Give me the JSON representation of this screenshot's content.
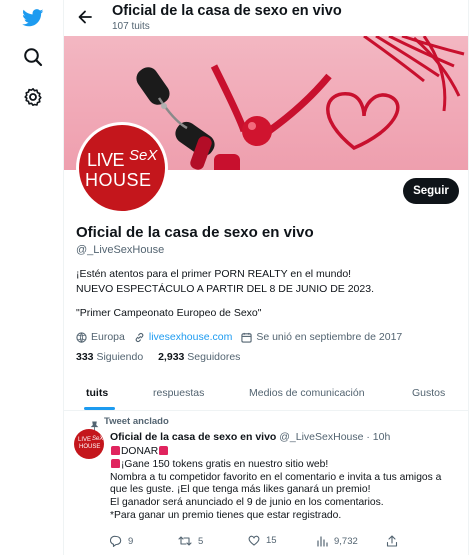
{
  "colors": {
    "brand": "#1d9bf0",
    "text": "#0f1419",
    "muted": "#536471",
    "logo_red": "#c4161c"
  },
  "nav": {
    "icons": [
      "twitter-logo",
      "search-icon",
      "gear-icon"
    ]
  },
  "header": {
    "title": "Oficial de la casa de sexo en vivo",
    "subtitle": "107 tuits"
  },
  "profile": {
    "logo_live": "LIVE",
    "logo_sex": "SeX",
    "logo_house": "HOUSE",
    "follow_label": "Seguir",
    "name": "Oficial de la casa de sexo en vivo",
    "handle": "@_LiveSexHouse",
    "bio_line1": "¡Estén atentos para el primer PORN REALTY en el mundo!",
    "bio_line2": "NUEVO ESPECTÁCULO A PARTIR DEL 8 DE JUNIO DE 2023.",
    "bio_quote": "\"Primer Campeonato Europeo de Sexo\"",
    "location": "Europa",
    "website": "livesexhouse.com",
    "joined": "Se unió en septiembre de 2017",
    "following_count": "333",
    "following_label": "Siguiendo",
    "followers_count": "2,933",
    "followers_label": "Seguidores"
  },
  "tabs": [
    {
      "label": "tuits"
    },
    {
      "label": "respuestas"
    },
    {
      "label": "Medios de comunicación"
    },
    {
      "label": "Gustos"
    }
  ],
  "tweet": {
    "pinned_label": "Tweet anclado",
    "name": "Oficial de la casa de sexo en vivo",
    "handle_time": "@_LiveSexHouse · 10h",
    "title": "DONAR",
    "lines": [
      "¡Gane 150 tokens gratis en nuestro sitio web!",
      "Nombra a tu competidor favorito en el comentario e invita a tus amigos a",
      "que les guste. ¡El que tenga más likes ganará un premio!",
      "El ganador será anunciado el 9 de junio en los comentarios.",
      "*Para ganar un premio tienes que estar registrado."
    ],
    "replies": "9",
    "retweets": "5",
    "likes": "15",
    "views": "9,732"
  }
}
